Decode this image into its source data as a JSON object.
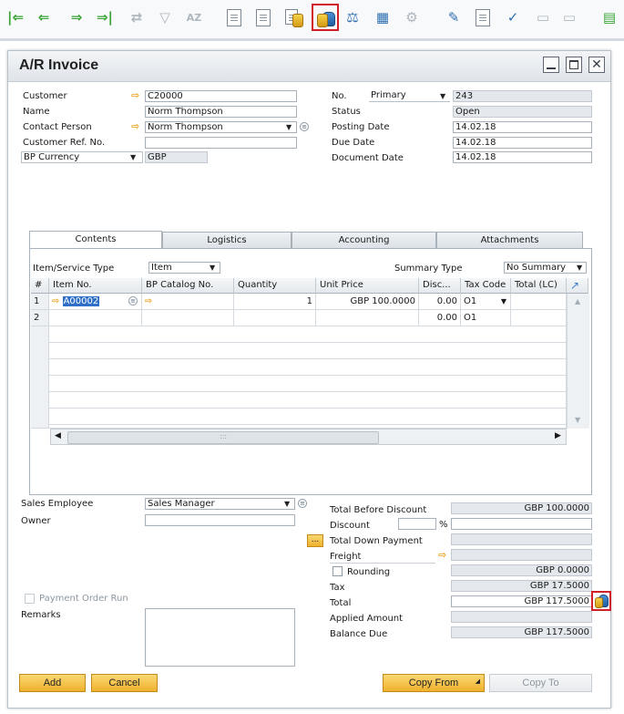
{
  "window": {
    "title": "A/R Invoice"
  },
  "header_left": {
    "customer_label": "Customer",
    "customer_value": "C20000",
    "name_label": "Name",
    "name_value": "Norm Thompson",
    "contact_label": "Contact Person",
    "contact_value": "Norm Thompson",
    "custref_label": "Customer Ref. No.",
    "custref_value": "",
    "currency_label": "BP Currency",
    "currency_value": "GBP"
  },
  "header_right": {
    "no_label": "No.",
    "series_value": "Primary",
    "no_value": "243",
    "status_label": "Status",
    "status_value": "Open",
    "posting_label": "Posting Date",
    "posting_value": "14.02.18",
    "due_label": "Due Date",
    "due_value": "14.02.18",
    "docdate_label": "Document Date",
    "docdate_value": "14.02.18"
  },
  "tabs": [
    "Contents",
    "Logistics",
    "Accounting",
    "Attachments"
  ],
  "contents": {
    "itemtype_label": "Item/Service Type",
    "itemtype_value": "Item",
    "summary_label": "Summary Type",
    "summary_value": "No Summary",
    "columns": [
      "#",
      "Item No.",
      "BP Catalog No.",
      "Quantity",
      "Unit Price",
      "Disc...",
      "Tax Code",
      "Total (LC)"
    ],
    "rows": [
      {
        "n": "1",
        "item": "A00002",
        "catalog": "",
        "qty": "1",
        "price": "GBP 100.0000",
        "disc": "0.00",
        "tax": "O1",
        "total": ""
      },
      {
        "n": "2",
        "item": "",
        "catalog": "",
        "qty": "",
        "price": "",
        "disc": "0.00",
        "tax": "O1",
        "total": ""
      }
    ]
  },
  "footer_left": {
    "employee_label": "Sales Employee",
    "employee_value": "Sales Manager",
    "owner_label": "Owner",
    "owner_value": "",
    "payment_order_label": "Payment Order Run",
    "remarks_label": "Remarks",
    "remarks_value": ""
  },
  "totals": {
    "before_discount_label": "Total Before Discount",
    "before_discount_value": "GBP 100.0000",
    "discount_label": "Discount",
    "discount_pct": "",
    "discount_sign": "%",
    "discount_value": "",
    "down_payment_label": "Total Down Payment",
    "down_payment_btn": "...",
    "down_payment_value": "",
    "freight_label": "Freight",
    "freight_value": "",
    "rounding_label": "Rounding",
    "rounding_value": "GBP 0.0000",
    "tax_label": "Tax",
    "tax_value": "GBP 17.5000",
    "total_label": "Total",
    "total_value": "GBP 117.5000",
    "applied_label": "Applied Amount",
    "applied_value": "",
    "balance_label": "Balance Due",
    "balance_value": "GBP 117.5000"
  },
  "buttons": {
    "add": "Add",
    "cancel": "Cancel",
    "copy_from": "Copy From",
    "copy_to": "Copy To"
  },
  "colors": {
    "accent": "#efb12d",
    "highlight": "#d0202a",
    "link_arrow": "#e9a21a"
  }
}
